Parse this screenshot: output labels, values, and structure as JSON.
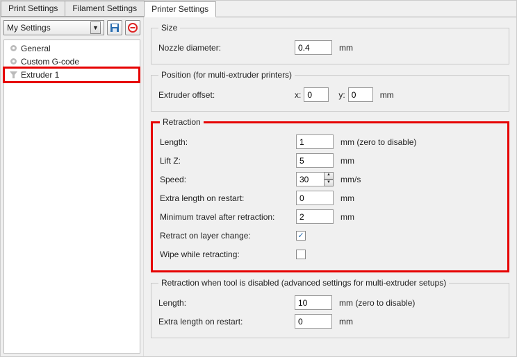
{
  "tabs": {
    "print": "Print Settings",
    "filament": "Filament Settings",
    "printer": "Printer Settings"
  },
  "preset": {
    "selected": "My Settings"
  },
  "tree": {
    "general": "General",
    "gcode": "Custom G-code",
    "extruder": "Extruder 1"
  },
  "groups": {
    "size": {
      "legend": "Size",
      "nozzle_label": "Nozzle diameter:",
      "nozzle_value": "0.4",
      "unit_mm": "mm"
    },
    "position": {
      "legend": "Position (for multi-extruder printers)",
      "offset_label": "Extruder offset:",
      "x_label": "x:",
      "x_value": "0",
      "y_label": "y:",
      "y_value": "0",
      "unit_mm": "mm"
    },
    "retraction": {
      "legend": "Retraction",
      "length_label": "Length:",
      "length_value": "1",
      "length_unit": "mm (zero to disable)",
      "liftz_label": "Lift Z:",
      "liftz_value": "5",
      "unit_mm": "mm",
      "speed_label": "Speed:",
      "speed_value": "30",
      "speed_unit": "mm/s",
      "extra_label": "Extra length on restart:",
      "extra_value": "0",
      "mintravel_label": "Minimum travel after retraction:",
      "mintravel_value": "2",
      "layer_label": "Retract on layer change:",
      "layer_checked": true,
      "wipe_label": "Wipe while retracting:",
      "wipe_checked": false
    },
    "retraction_disabled": {
      "legend": "Retraction when tool is disabled (advanced settings for multi-extruder setups)",
      "length_label": "Length:",
      "length_value": "10",
      "length_unit": "mm (zero to disable)",
      "extra_label": "Extra length on restart:",
      "extra_value": "0",
      "unit_mm": "mm"
    }
  }
}
